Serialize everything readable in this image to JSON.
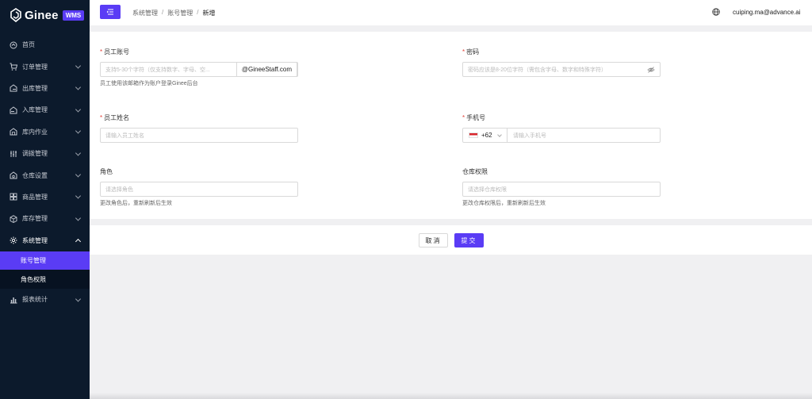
{
  "sidebar": {
    "logo_text": "Ginee",
    "logo_badge": "WMS",
    "items": [
      {
        "label": "首页",
        "icon": "home-icon",
        "has_children": false
      },
      {
        "label": "订单管理",
        "icon": "cart-icon",
        "has_children": true
      },
      {
        "label": "出库管理",
        "icon": "outbound-icon",
        "has_children": true
      },
      {
        "label": "入库管理",
        "icon": "inbound-icon",
        "has_children": true
      },
      {
        "label": "库内作业",
        "icon": "warehouse-op-icon",
        "has_children": true
      },
      {
        "label": "调拨管理",
        "icon": "transfer-icon",
        "has_children": true
      },
      {
        "label": "仓库设置",
        "icon": "warehouse-settings-icon",
        "has_children": true
      },
      {
        "label": "商品管理",
        "icon": "product-icon",
        "has_children": true
      },
      {
        "label": "库存管理",
        "icon": "inventory-icon",
        "has_children": true
      },
      {
        "label": "系统管理",
        "icon": "gear-icon",
        "has_children": true,
        "open": true,
        "children": [
          {
            "label": "账号管理",
            "active": true
          },
          {
            "label": "角色权限",
            "active": false
          }
        ]
      },
      {
        "label": "报表统计",
        "icon": "report-icon",
        "has_children": true
      }
    ]
  },
  "header": {
    "breadcrumb": [
      "系统管理",
      "账号管理",
      "新增"
    ],
    "user_email": "cuiping.ma@advance.ai"
  },
  "form": {
    "account": {
      "label": "员工账号",
      "placeholder": "支持5-30个字符（仅支持数字、字母、空...",
      "suffix": "@GineeStaff.com",
      "hint": "员工使用该邮箱作为账户登录Ginee后台"
    },
    "password": {
      "label": "密码",
      "placeholder": "密码应该是8-20位字符（需包含字母、数字和特殊字符）"
    },
    "name": {
      "label": "员工姓名",
      "placeholder": "请输入员工姓名"
    },
    "phone": {
      "label": "手机号",
      "country_code": "+62",
      "placeholder": "请输入手机号"
    },
    "role": {
      "label": "角色",
      "placeholder": "请选择角色",
      "hint": "更改角色后，重新刷新后生效"
    },
    "warehouse": {
      "label": "仓库权限",
      "placeholder": "请选择仓库权限",
      "hint": "更改仓库权限后，重新刷新后生效"
    }
  },
  "actions": {
    "cancel": "取消",
    "submit": "提交"
  },
  "colors": {
    "accent": "#5a3cf5",
    "sidebar_bg": "#0c1a2c",
    "required": "#e2453c"
  }
}
